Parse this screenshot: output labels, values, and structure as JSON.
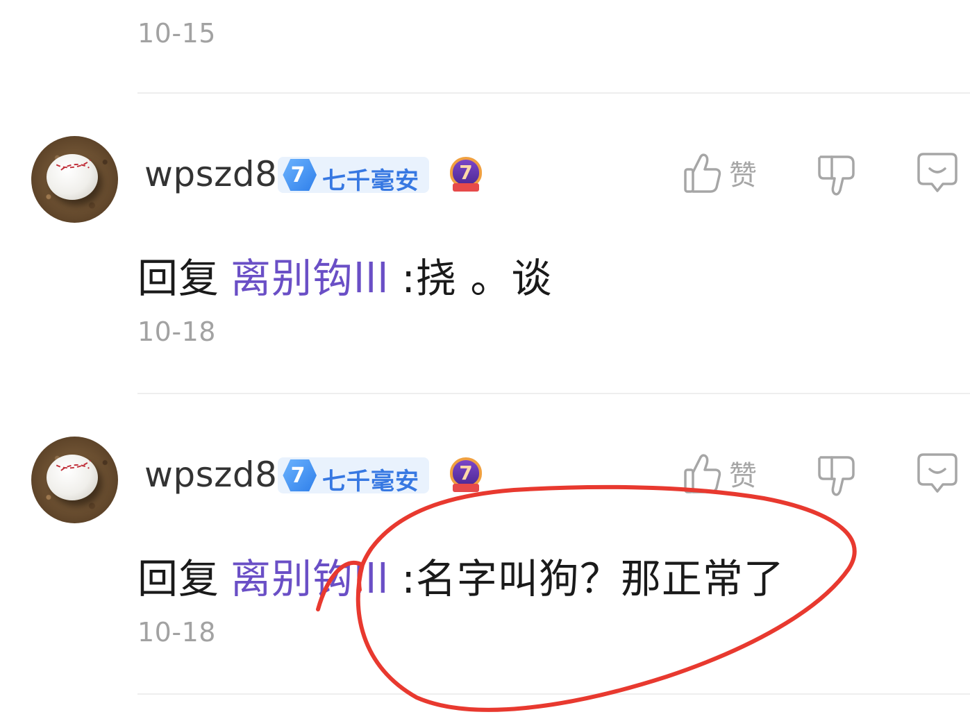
{
  "top_date": "10-15",
  "action_labels": {
    "like": "赞"
  },
  "comments": [
    {
      "username": "wpszd8",
      "level": "7",
      "level_name": "七千毫安",
      "fan_level": "7",
      "reply_prefix": "回复",
      "mention": "离别钩lll",
      "content": ":挠 。谈",
      "date": "10-18"
    },
    {
      "username": "wpszd8",
      "level": "7",
      "level_name": "七千毫安",
      "fan_level": "7",
      "reply_prefix": "回复",
      "mention": "离别钩lll",
      "content": ":名字叫狗？那正常了",
      "date": "10-18"
    }
  ],
  "annotation_color": "#e8392f"
}
